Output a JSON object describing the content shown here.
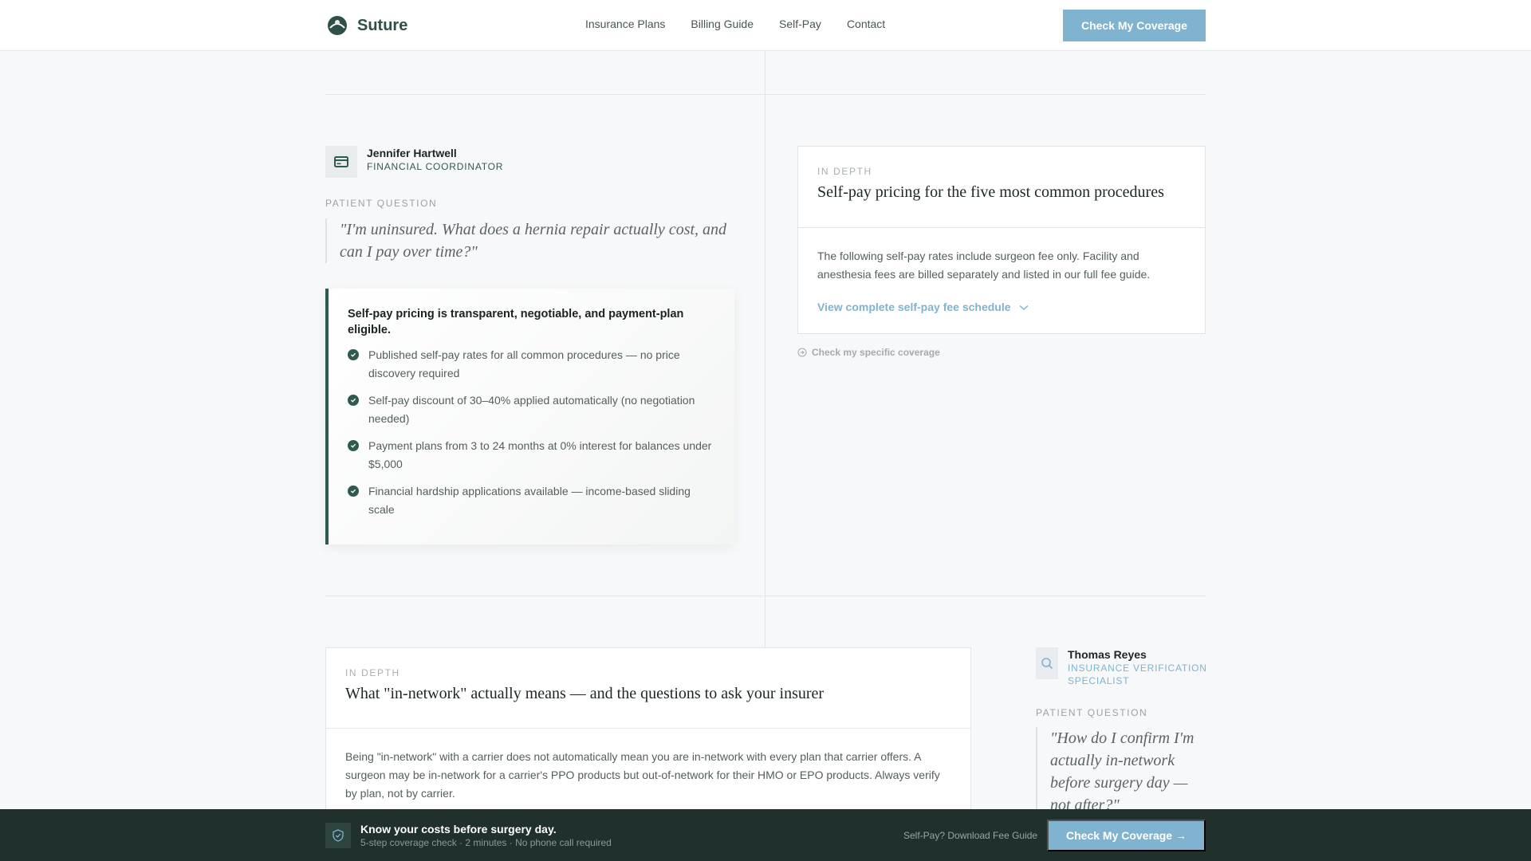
{
  "header": {
    "brand": "Suture",
    "nav": [
      "Insurance Plans",
      "Billing Guide",
      "Self-Pay",
      "Contact"
    ],
    "cta": "Check My Coverage"
  },
  "section1": {
    "coordinator": {
      "name": "Jennifer Hartwell",
      "role": "FINANCIAL COORDINATOR",
      "icon": "credit-card-icon"
    },
    "question_label": "PATIENT QUESTION",
    "question": "\"I'm uninsured. What does a hernia repair actually cost, and can I pay over time?\"",
    "callout": {
      "title": "Self-pay pricing is transparent, negotiable, and payment-plan eligible.",
      "items": [
        "Published self-pay rates for all common procedures — no price discovery required",
        "Self-pay discount of 30–40% applied automatically (no negotiation needed)",
        "Payment plans from 3 to 24 months at 0% interest for balances under $5,000",
        "Financial hardship applications available — income-based sliding scale"
      ]
    },
    "in_depth": {
      "eyebrow": "IN DEPTH",
      "title": "Self-pay pricing for the five most common procedures",
      "body": "The following self-pay rates include surgeon fee only. Facility and anesthesia fees are billed separately and listed in our full fee guide.",
      "link": "View complete self-pay fee schedule"
    },
    "coverage_link": "Check my specific coverage"
  },
  "section2": {
    "in_depth": {
      "eyebrow": "IN DEPTH",
      "title": "What \"in-network\" actually means — and the questions to ask your insurer",
      "body": "Being \"in-network\" with a carrier does not automatically mean you are in-network with every plan that carrier offers. A surgeon may be in-network for a carrier's PPO products but out-of-network for their HMO or EPO products. Always verify by plan, not by carrier."
    },
    "coordinator": {
      "name": "Thomas Reyes",
      "role_line1": "INSURANCE VERIFICATION",
      "role_line2": "SPECIALIST",
      "icon": "search-icon"
    },
    "question_label": "PATIENT QUESTION",
    "question": "\"How do I confirm I'm actually in-network before surgery day — not after?\""
  },
  "bottom_bar": {
    "title": "Know your costs before surgery day.",
    "subtitle": "5-step coverage check · 2 minutes · No phone call required",
    "link": "Self-Pay? Download Fee Guide",
    "cta": "Check My Coverage →"
  },
  "colors": {
    "brand_green": "#2f5a50",
    "accent_blue": "#7fb3cf",
    "bar_dark": "#20302d"
  }
}
